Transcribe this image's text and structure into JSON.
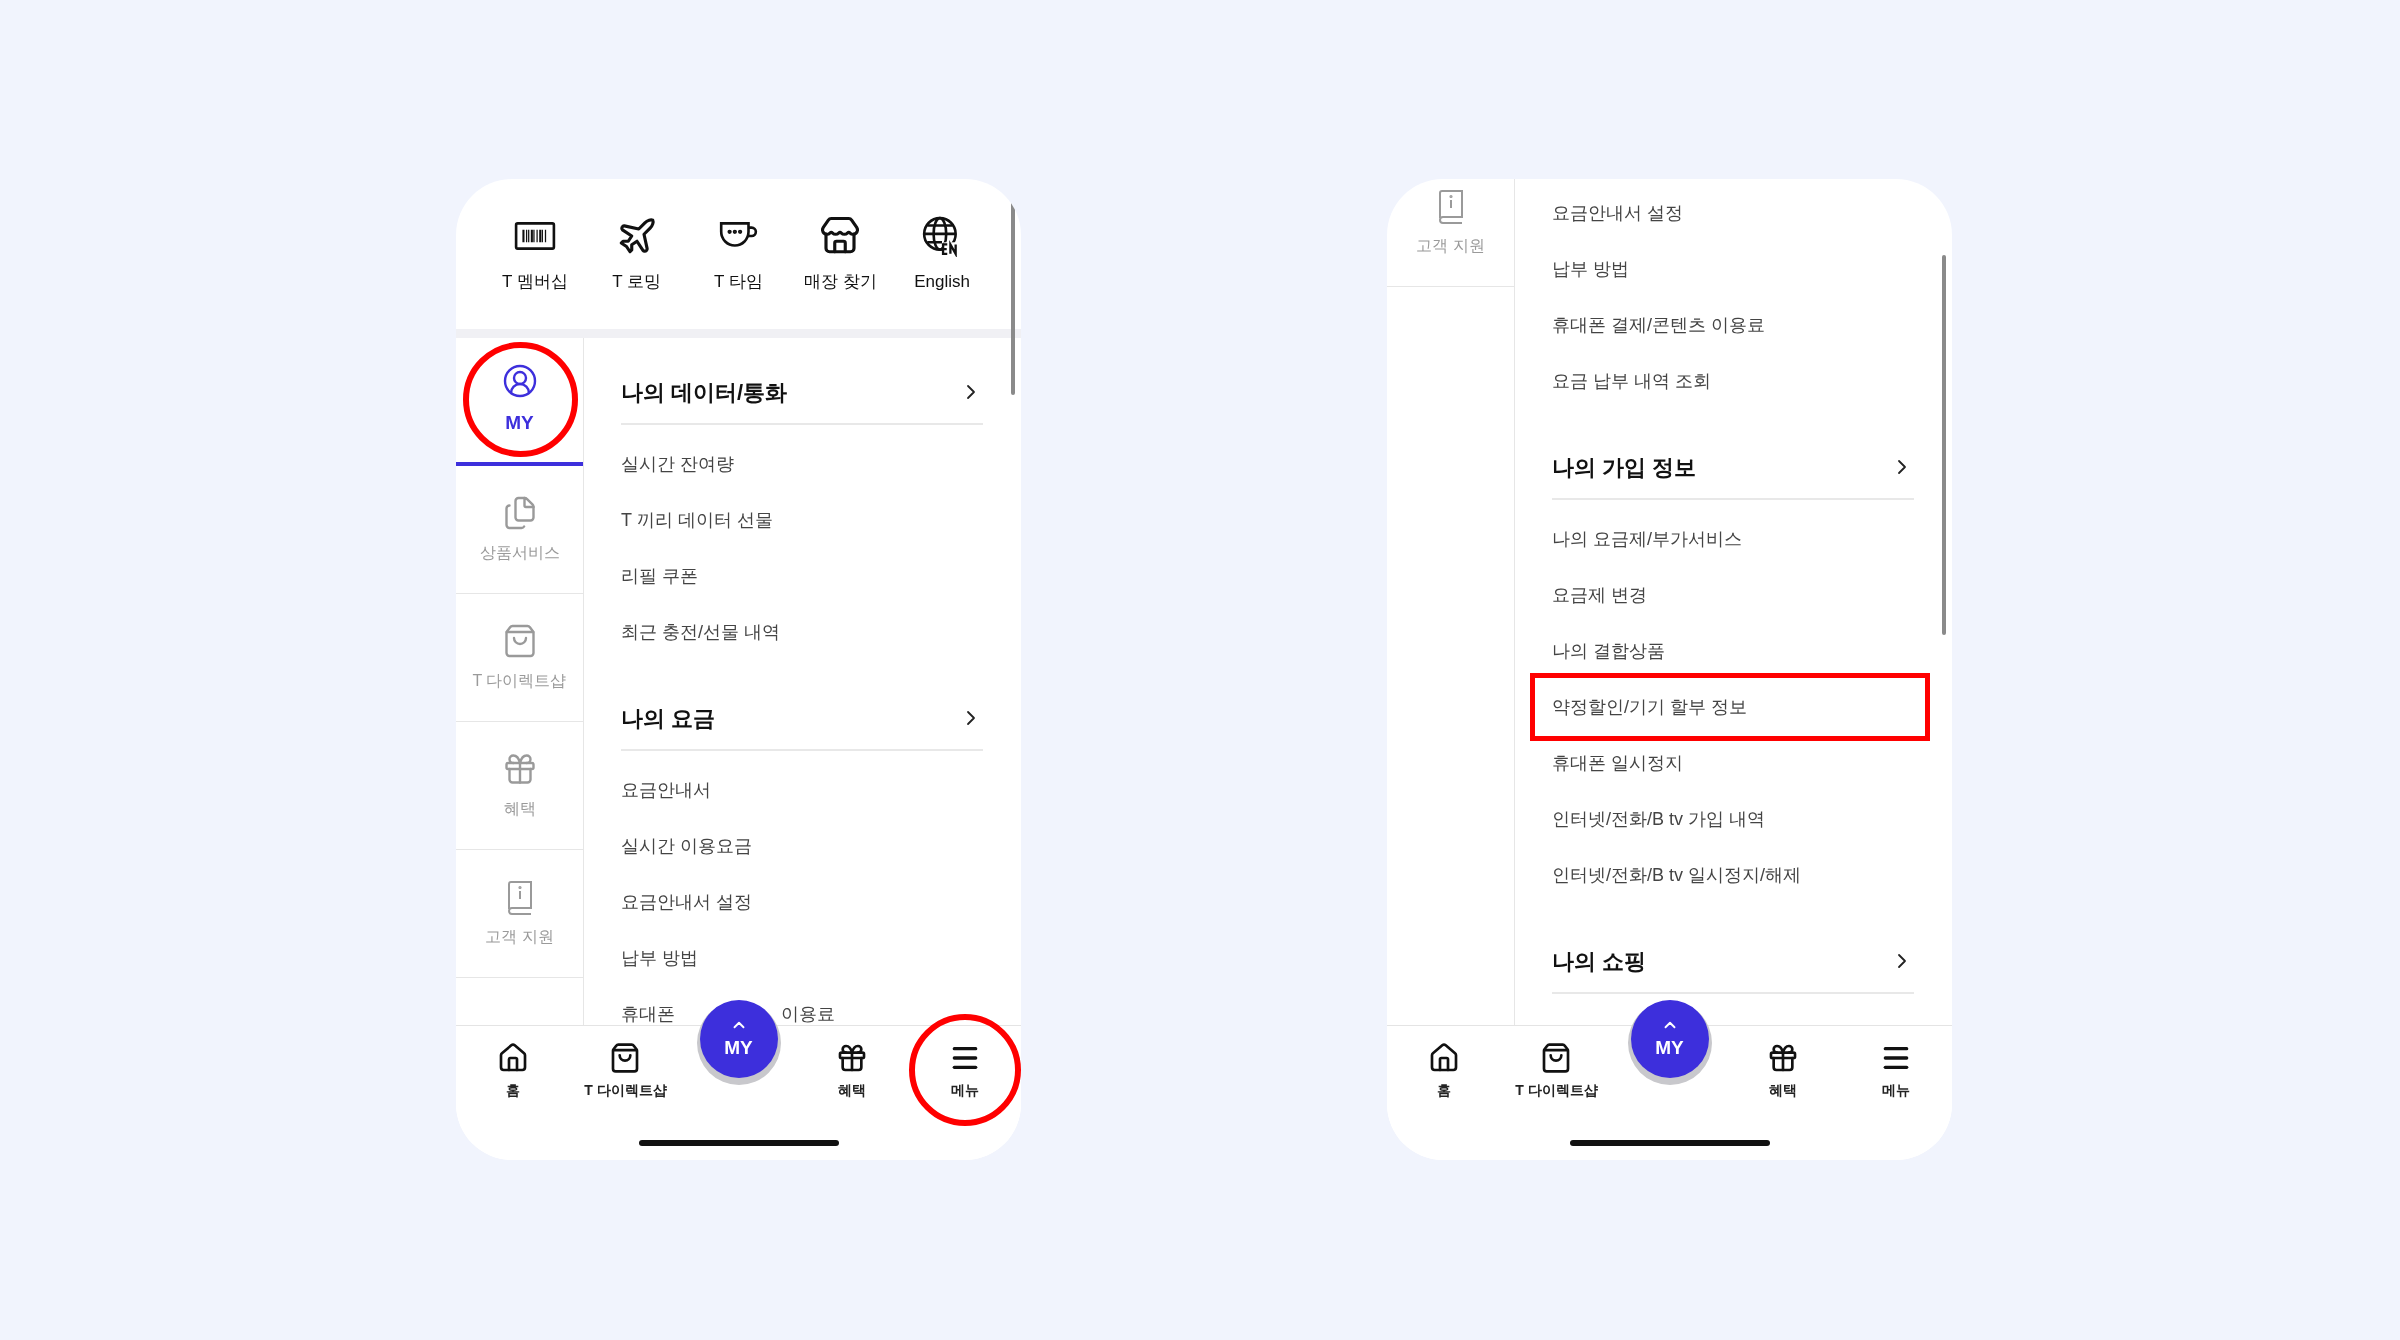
{
  "phones": [
    {
      "quick_menu": [
        {
          "kind": "membership",
          "label": "T 멤버십"
        },
        {
          "kind": "roaming",
          "label": "T 로밍"
        },
        {
          "kind": "time",
          "label": "T 타임"
        },
        {
          "kind": "store",
          "label": "매장 찾기"
        },
        {
          "kind": "english",
          "label": "English"
        }
      ],
      "side_nav": [
        {
          "kind": "my",
          "label": "MY",
          "selected": true,
          "annotated": true
        },
        {
          "kind": "products",
          "label": "상품서비스",
          "selected": false,
          "annotated": false
        },
        {
          "kind": "shop",
          "label": "T 다이렉트샵",
          "selected": false,
          "annotated": false
        },
        {
          "kind": "benefits",
          "label": "혜택",
          "selected": false,
          "annotated": false
        },
        {
          "kind": "support",
          "label": "고객 지원",
          "selected": false,
          "annotated": false
        }
      ],
      "sections": [
        {
          "title": "나의 데이터/통화",
          "items": [
            {
              "label": "실시간 잔여량",
              "annotated": false
            },
            {
              "label": "T 끼리 데이터 선물",
              "annotated": false
            },
            {
              "label": "리필 쿠폰",
              "annotated": false
            },
            {
              "label": "최근 충전/선물 내역",
              "annotated": false
            }
          ]
        },
        {
          "title": "나의 요금",
          "items": [
            {
              "label": "요금안내서",
              "annotated": false
            },
            {
              "label": "실시간 이용요금",
              "annotated": false
            },
            {
              "label": "요금안내서 설정",
              "annotated": false
            },
            {
              "label": "납부 방법",
              "annotated": false
            },
            {
              "label": "휴대폰",
              "label_end": "이용료",
              "annotated": false
            }
          ]
        }
      ],
      "my_button": {
        "label": "MY"
      },
      "bottom_nav": [
        {
          "kind": "home",
          "label": "홈",
          "annotated": false
        },
        {
          "kind": "shop",
          "label": "T 다이렉트샵",
          "annotated": false
        },
        {
          "kind": "benefits",
          "label": "혜택",
          "annotated": false
        },
        {
          "kind": "menu",
          "label": "메뉴",
          "annotated": true
        }
      ]
    },
    {
      "side_nav": [
        {
          "kind": "support",
          "label": "고객 지원",
          "selected": false,
          "annotated": false
        }
      ],
      "sections": [
        {
          "items": [
            {
              "label": "요금안내서 설정",
              "annotated": false
            },
            {
              "label": "납부 방법",
              "annotated": false
            },
            {
              "label": "휴대폰 결제/콘텐츠 이용료",
              "annotated": false
            },
            {
              "label": "요금 납부 내역 조회",
              "annotated": false
            }
          ]
        },
        {
          "title": "나의 가입 정보",
          "items": [
            {
              "label": "나의 요금제/부가서비스",
              "annotated": false
            },
            {
              "label": "요금제 변경",
              "annotated": false
            },
            {
              "label": "나의 결합상품",
              "annotated": false
            },
            {
              "label": "약정할인/기기 할부 정보",
              "annotated": true
            },
            {
              "label": "휴대폰 일시정지",
              "annotated": false
            },
            {
              "label": "인터넷/전화/B tv 가입 내역",
              "annotated": false
            },
            {
              "label": "인터넷/전화/B tv 일시정지/해제",
              "annotated": false
            }
          ]
        },
        {
          "title": "나의 쇼핑"
        }
      ],
      "my_button": {
        "label": "MY"
      },
      "bottom_nav": [
        {
          "kind": "home",
          "label": "홈",
          "annotated": false
        },
        {
          "kind": "shop",
          "label": "T 다이렉트샵",
          "annotated": false
        },
        {
          "kind": "benefits",
          "label": "혜택",
          "annotated": false
        },
        {
          "kind": "menu",
          "label": "메뉴",
          "annotated": false
        }
      ]
    }
  ]
}
